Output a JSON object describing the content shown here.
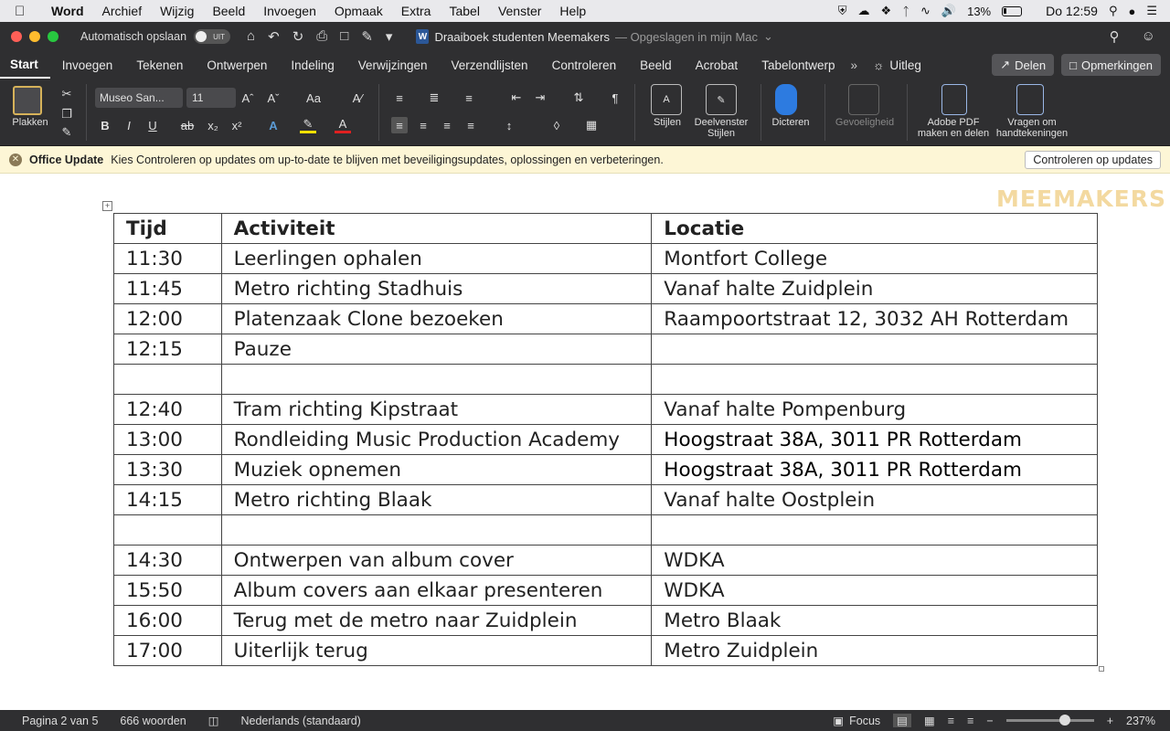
{
  "menubar": {
    "apple_icon": "apple-icon",
    "app": "Word",
    "items": [
      "Archief",
      "Wijzig",
      "Beeld",
      "Invoegen",
      "Opmaak",
      "Extra",
      "Tabel",
      "Venster",
      "Help"
    ],
    "battery": "13%",
    "clock": "Do 12:59"
  },
  "titlebar": {
    "autosave_label": "Automatisch opslaan",
    "autosave_state": "UIT",
    "doc_name": "Draaiboek studenten Meemakers",
    "doc_status": "— Opgeslagen in mijn Mac"
  },
  "tabs": {
    "items": [
      "Start",
      "Invoegen",
      "Tekenen",
      "Ontwerpen",
      "Indeling",
      "Verwijzingen",
      "Verzendlijsten",
      "Controleren",
      "Beeld",
      "Acrobat",
      "Tabelontwerp"
    ],
    "active": "Start",
    "tell_me": "Uitleg",
    "share": "Delen",
    "comments": "Opmerkingen"
  },
  "ribbon": {
    "paste": "Plakken",
    "font_name": "Museo San...",
    "font_size": "11",
    "styles": "Stijlen",
    "styles_pane_1": "Deelvenster",
    "styles_pane_2": "Stijlen",
    "dictate": "Dicteren",
    "sensitivity": "Gevoeligheid",
    "adobe_1": "Adobe PDF",
    "adobe_2": "maken en delen",
    "sign_1": "Vragen om",
    "sign_2": "handtekeningen"
  },
  "update_bar": {
    "title": "Office Update",
    "message": "Kies Controleren op updates om up-to-date te blijven met beveiligingsupdates, oplossingen en verbeteringen.",
    "button": "Controleren op updates"
  },
  "document": {
    "watermark": "MEEMAKERS",
    "headers": [
      "Tijd",
      "Activiteit",
      "Locatie"
    ],
    "rows": [
      [
        "11:30",
        "Leerlingen ophalen",
        "Montfort College"
      ],
      [
        "11:45",
        "Metro richting Stadhuis",
        "Vanaf halte Zuidplein"
      ],
      [
        "12:00",
        "Platenzaak Clone bezoeken",
        "Raampoortstraat 12, 3032 AH Rotterdam"
      ],
      [
        "12:15",
        "Pauze",
        ""
      ],
      [
        "",
        "",
        ""
      ],
      [
        "12:40",
        "Tram richting Kipstraat",
        "Vanaf halte Pompenburg"
      ],
      [
        "13:00",
        "Rondleiding Music Production Academy",
        "Hoogstraat 38A, 3011 PR Rotterdam"
      ],
      [
        "13:30",
        "Muziek opnemen",
        "Hoogstraat 38A, 3011 PR Rotterdam"
      ],
      [
        "14:15",
        "Metro richting Blaak",
        "Vanaf halte Oostplein"
      ],
      [
        "",
        "",
        ""
      ],
      [
        "14:30",
        "Ontwerpen van album cover",
        "WDKA"
      ],
      [
        "15:50",
        "Album covers aan elkaar presenteren",
        "WDKA"
      ],
      [
        "16:00",
        "Terug met de metro naar Zuidplein",
        "Metro Blaak"
      ],
      [
        "17:00",
        "Uiterlijk terug",
        "Metro Zuidplein"
      ]
    ]
  },
  "statusbar": {
    "page": "Pagina 2 van 5",
    "words": "666 woorden",
    "language": "Nederlands (standaard)",
    "focus": "Focus",
    "zoom": "237%"
  }
}
